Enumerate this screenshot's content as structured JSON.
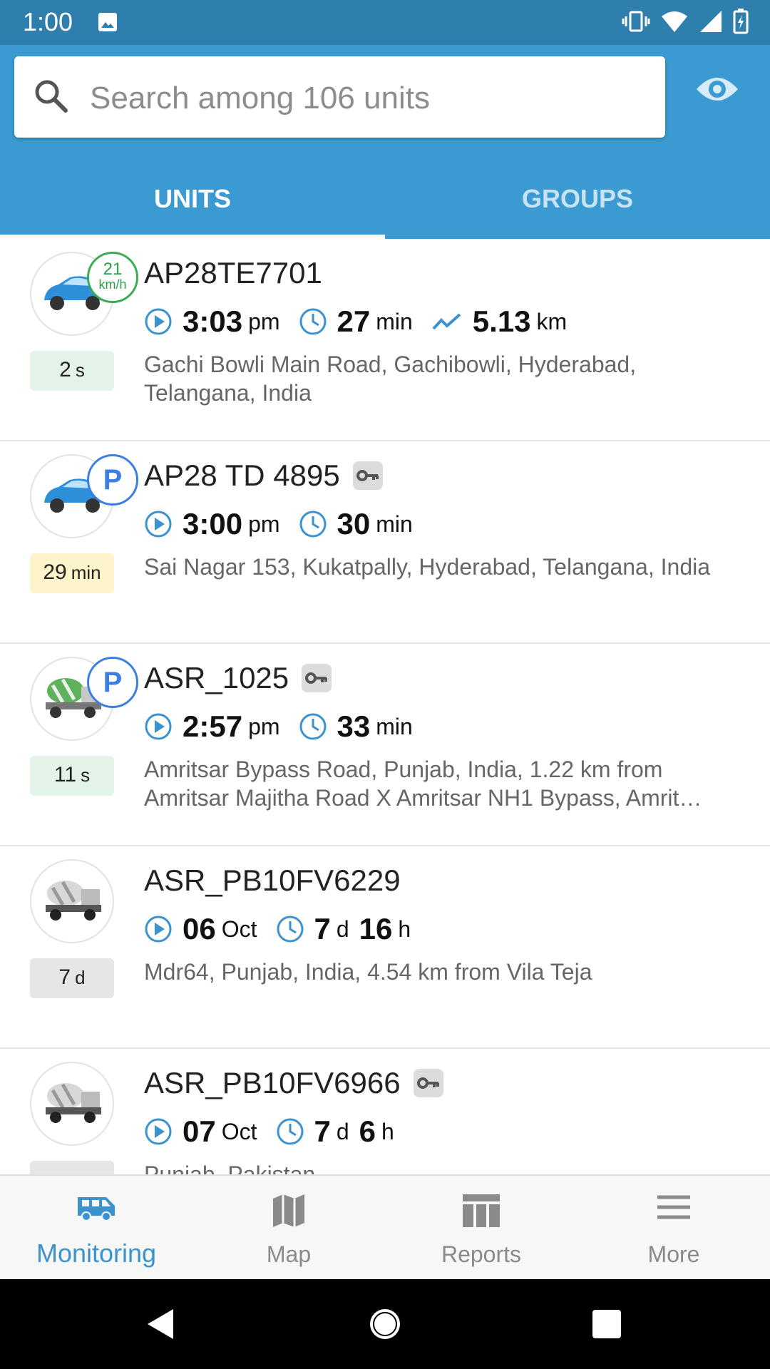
{
  "status_bar": {
    "time": "1:00"
  },
  "search": {
    "placeholder": "Search among 106 units"
  },
  "tabs": [
    {
      "label": "UNITS"
    },
    {
      "label": "GROUPS"
    }
  ],
  "units": [
    {
      "name": "AP28TE7701",
      "speed_value": "21",
      "speed_unit": "km/h",
      "age_value": "2",
      "age_unit": "s",
      "time_value": "3:03",
      "time_unit": "pm",
      "duration_value": "27",
      "duration_unit": "min",
      "distance_value": "5.13",
      "distance_unit": "km",
      "address": "Gachi Bowli Main Road, Gachibowli, Hyderabad, Telangana, India"
    },
    {
      "name": "AP28 TD 4895",
      "parking_label": "P",
      "age_value": "29",
      "age_unit": "min",
      "time_value": "3:00",
      "time_unit": "pm",
      "duration_value": "30",
      "duration_unit": "min",
      "address": "Sai Nagar 153, Kukatpally, Hyderabad, Telangana, India"
    },
    {
      "name": "ASR_1025",
      "parking_label": "P",
      "age_value": "11",
      "age_unit": "s",
      "time_value": "2:57",
      "time_unit": "pm",
      "duration_value": "33",
      "duration_unit": "min",
      "address": "Amritsar Bypass Road, Punjab, India, 1.22 km from Amritsar Majitha Road X Amritsar NH1 Bypass, Amrit…"
    },
    {
      "name": "ASR_PB10FV6229",
      "age_value": "7",
      "age_unit": "d",
      "time_value": "06",
      "time_unit": "Oct",
      "duration_value": "7",
      "duration_unit": "d",
      "duration_value2": "16",
      "duration_unit2": "h",
      "address": "Mdr64, Punjab, India, 4.54 km from Vila Teja"
    },
    {
      "name": "ASR_PB10FV6966",
      "time_value": "07",
      "time_unit": "Oct",
      "duration_value": "7",
      "duration_unit": "d",
      "duration_value2": "6",
      "duration_unit2": "h",
      "address": "Punjab, Pakistan"
    }
  ],
  "bottom_nav": [
    {
      "label": "Monitoring",
      "icon": "van-icon"
    },
    {
      "label": "Map",
      "icon": "map-icon"
    },
    {
      "label": "Reports",
      "icon": "table-icon"
    },
    {
      "label": "More",
      "icon": "menu-icon"
    }
  ],
  "colors": {
    "header": "#3a9ad1",
    "status_bar": "#2f7fae",
    "accent": "#3a92cf",
    "moving": "#3cab55",
    "parked": "#3c7ee3"
  }
}
